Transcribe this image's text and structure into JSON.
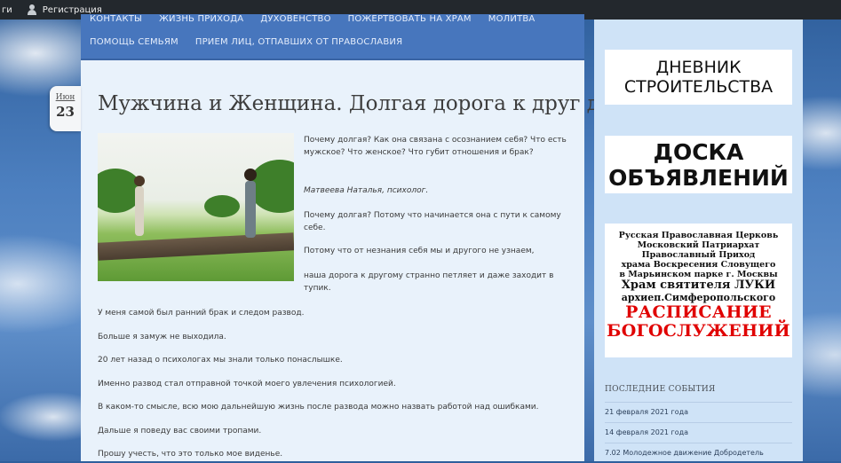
{
  "admin_bar": {
    "leading_text": "ги",
    "register_label": "Регистрация",
    "user_icon": "user-icon"
  },
  "nav": {
    "row1": [
      "КОНТАКТЫ",
      "ЖИЗНЬ ПРИХОДА",
      "ДУХОВЕНСТВО",
      "ПОЖЕРТВОВАТЬ НА ХРАМ",
      "МОЛИТВА"
    ],
    "row2": [
      "ПОМОЩЬ СЕМЬЯМ",
      "ПРИЕМ ЛИЦ, ОТПАВШИХ ОТ ПРАВОСЛАВИЯ"
    ]
  },
  "post": {
    "date_month": "Июн",
    "date_day": "23",
    "title": "Мужчина и Женщина. Долгая дорога к друг другу",
    "side_paragraphs": [
      "Почему долгая? Как она связана с осознанием себя? Что есть мужское? Что женское? Что губит отношения и брак?",
      "Матвеева Наталья, психолог.",
      "Почему долгая? Потому что начинается она с пути к самому себе.",
      "Потому что от незнания себя мы и другого не узнаем,",
      "наша дорога к другому странно петляет и даже заходит в тупик."
    ],
    "paragraphs": [
      "У меня самой был ранний брак и следом развод.",
      "Больше я замуж не выходила.",
      "20 лет назад о психологах мы знали только понаслышке.",
      "Именно развод стал отправной точкой моего увлечения психологией.",
      "В каком-то смысле, всю мою дальнейшую жизнь после развода можно назвать работой над ошибками.",
      "Дальше я поведу вас своими тропами.",
      "Прошу учесть, что это только мое виденье."
    ]
  },
  "sidebar": {
    "diary": [
      "ДНЕВНИК",
      "СТРОИТЕЛЬСТВА"
    ],
    "board": [
      "ДОСКА",
      "ОБЪЯВЛЕНИЙ"
    ],
    "schedule": {
      "lines": [
        "Русская Православная Церковь",
        "Московский Патриархат",
        "Православный Приход",
        "храма Воскресения Словущего",
        "в Марьинском парке  г. Москвы"
      ],
      "church": "Храм святителя ЛУКИ",
      "archbishop": "архиеп.Симферопольского",
      "title1": "РАСПИСАНИЕ",
      "title2": "БОГОСЛУЖЕНИЙ"
    },
    "recent_heading": "ПОСЛЕДНИЕ СОБЫТИЯ",
    "recent_items": [
      "21 февраля 2021 года",
      "14 февраля 2021 года",
      "7.02 Молодежное движение Добродетель"
    ]
  }
}
